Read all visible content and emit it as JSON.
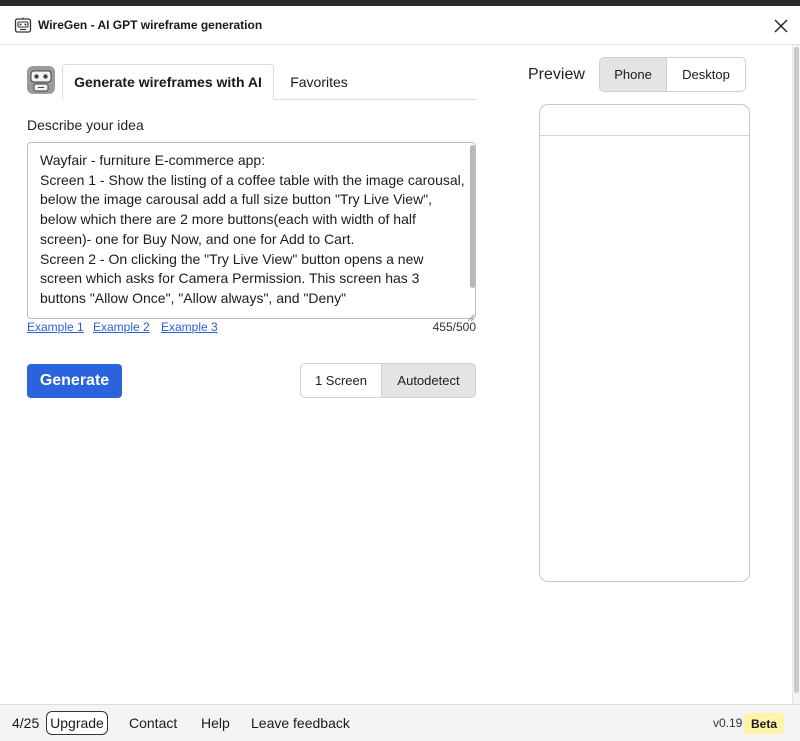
{
  "window": {
    "title": "WireGen - AI GPT wireframe generation",
    "app_icon": "robot-face-icon",
    "close_icon": "close-icon"
  },
  "tabs": [
    {
      "label": "Generate wireframes with AI",
      "active": true
    },
    {
      "label": "Favorites",
      "active": false
    }
  ],
  "idea": {
    "label": "Describe your idea",
    "text": "Wayfair - furniture E-commerce app:\nScreen 1 - Show the listing of a coffee table with the image carousal, below the image carousal add a full size button \"Try Live View\", below which there are 2 more buttons(each with width of half screen)- one for Buy Now, and one for Add to Cart.\nScreen 2 - On clicking the \"Try Live View\" button opens a new screen which asks for Camera Permission. This screen has 3 buttons \"Allow Once\", \"Allow always\", and \"Deny\"",
    "examples": [
      "Example 1",
      "Example 2",
      "Example 3"
    ],
    "char_count": "455/500"
  },
  "generate": {
    "button_label": "Generate",
    "screen_options": [
      {
        "label": "1 Screen",
        "selected": false
      },
      {
        "label": "Autodetect",
        "selected": true
      }
    ]
  },
  "preview": {
    "label": "Preview",
    "devices": [
      {
        "label": "Phone",
        "selected": true
      },
      {
        "label": "Desktop",
        "selected": false
      }
    ]
  },
  "footer": {
    "credits": "4/25",
    "upgrade_label": "Upgrade",
    "links": [
      "Contact",
      "Help",
      "Leave feedback"
    ],
    "version": "v0.19",
    "badge": "Beta"
  },
  "colors": {
    "accent": "#2b63dc",
    "link": "#2a5fd4",
    "badge_bg": "#fff3a8",
    "selected_segment": "#e4e4e4"
  }
}
